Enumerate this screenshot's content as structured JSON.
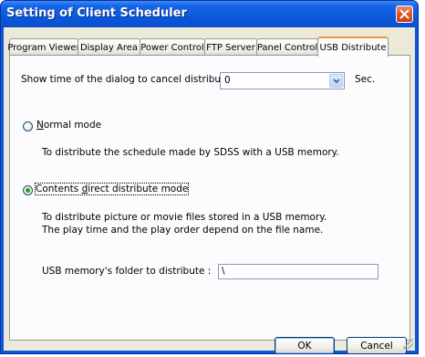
{
  "window": {
    "title": "Setting of Client Scheduler",
    "title_color": "#0a57d8"
  },
  "tabs": [
    {
      "label": "Program Viewer",
      "active": false
    },
    {
      "label": "Display Area",
      "active": false
    },
    {
      "label": "Power Control",
      "active": false
    },
    {
      "label": "FTP Server",
      "active": false
    },
    {
      "label": "Panel Control",
      "active": false
    },
    {
      "label": "USB Distribute",
      "active": true
    }
  ],
  "usb": {
    "show_time_label": "Show time of the dialog to cancel distribution:",
    "show_time_value": "0",
    "sec_label": "Sec.",
    "normal_mode": {
      "label_prefix": "",
      "label_accel": "N",
      "label_rest": "ormal mode",
      "description": "To distribute the schedule made by SDSS with a USB memory.",
      "checked": false
    },
    "direct_mode": {
      "label_prefix": "Contents ",
      "label_accel": "d",
      "label_rest": "irect distribute mode",
      "description_line1": "To distribute picture or movie files stored in a USB memory.",
      "description_line2": "The play time and the play order depend on the file name.",
      "checked": true
    },
    "folder_label": "USB memory's folder to distribute :",
    "folder_value": "\\"
  },
  "buttons": {
    "ok": "OK",
    "cancel": "Cancel"
  }
}
